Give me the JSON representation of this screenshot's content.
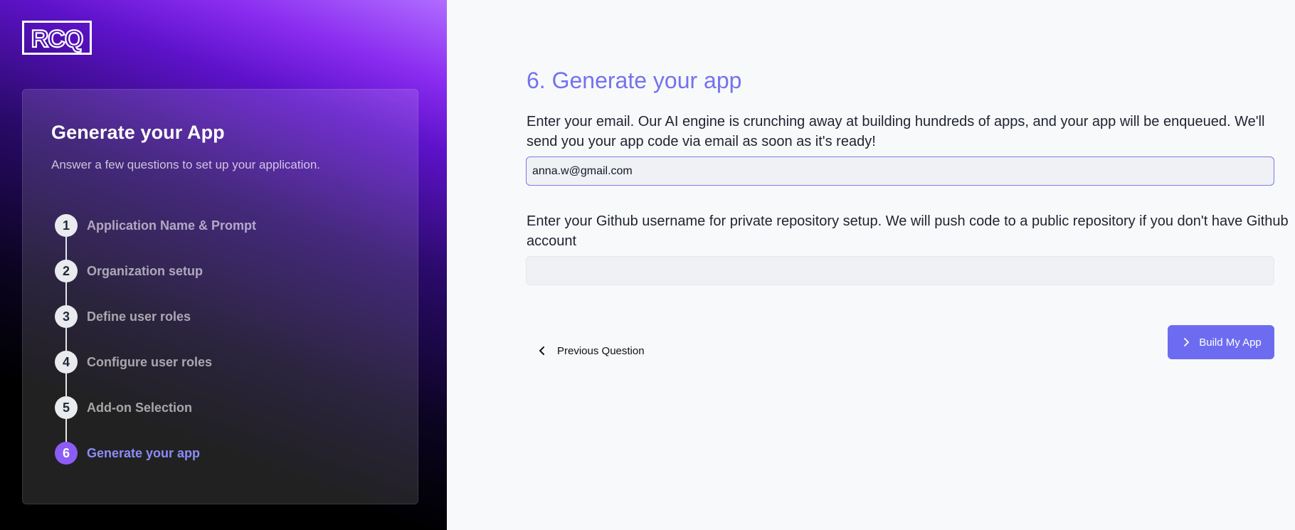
{
  "brand": {
    "logo_text": "RCQ"
  },
  "sidebar": {
    "title": "Generate your App",
    "subtitle": "Answer a few questions to set up your application.",
    "steps": [
      {
        "number": "1",
        "label": "Application Name & Prompt",
        "active": false
      },
      {
        "number": "2",
        "label": "Organization setup",
        "active": false
      },
      {
        "number": "3",
        "label": "Define user roles",
        "active": false
      },
      {
        "number": "4",
        "label": "Configure user roles",
        "active": false
      },
      {
        "number": "5",
        "label": "Add-on Selection",
        "active": false
      },
      {
        "number": "6",
        "label": "Generate your app",
        "active": true
      }
    ]
  },
  "main": {
    "title": "6. Generate your app",
    "email_prompt": "Enter your email. Our AI engine is crunching away at building hundreds of apps, and your app will be enqueued. We'll send you your app code via email as soon as it's ready!",
    "email_value": "anna.w@gmail.com",
    "github_prompt": "Enter your Github username for private repository setup. We will push code to a public repository if you don't have Github account",
    "github_value": "",
    "previous_label": "Previous Question",
    "build_label": "Build My App"
  },
  "colors": {
    "accent": "#6d6cf1",
    "title": "#7472ee",
    "active_step": "#8b5cf6"
  }
}
